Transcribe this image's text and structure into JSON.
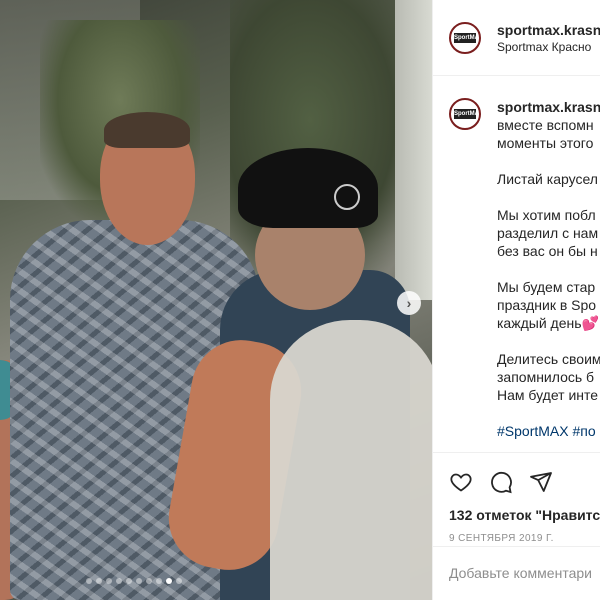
{
  "post": {
    "username": "sportmax.krasn",
    "location": "Sportmax Красно",
    "avatar_label": "SportMAX",
    "caption_lines": [
      {
        "text": "вместе вспомн"
      },
      {
        "text": "моменты этого"
      },
      {
        "text": ""
      },
      {
        "text": "Листай карусел"
      },
      {
        "text": ""
      },
      {
        "text": "Мы хотим побл"
      },
      {
        "text": "разделил с нам"
      },
      {
        "text": "без вас он бы н"
      },
      {
        "text": ""
      },
      {
        "text": "Мы будем стар"
      },
      {
        "text": "праздник в Spo"
      },
      {
        "text": "каждый день💕"
      },
      {
        "text": ""
      },
      {
        "text": "Делитесь своим"
      },
      {
        "text": "запомнилось б"
      },
      {
        "text": "Нам будет инте"
      },
      {
        "text": ""
      },
      {
        "text": "#SportMAX #по"
      }
    ],
    "likes": "132 отметок \"Нравитс",
    "date": "9 СЕНТЯБРЯ 2019 Г.",
    "comment_placeholder": "Добавьте комментари",
    "carousel": {
      "total_dots": 10,
      "active_index": 8
    }
  },
  "icons": {
    "like": "heart-icon",
    "comment": "comment-icon",
    "share": "share-icon",
    "next": "chevron-right-icon"
  },
  "colors": {
    "avatar_ring": "#7a1e1e",
    "hashtag": "#00376b",
    "muted": "#8e8e8e",
    "text": "#262626"
  }
}
